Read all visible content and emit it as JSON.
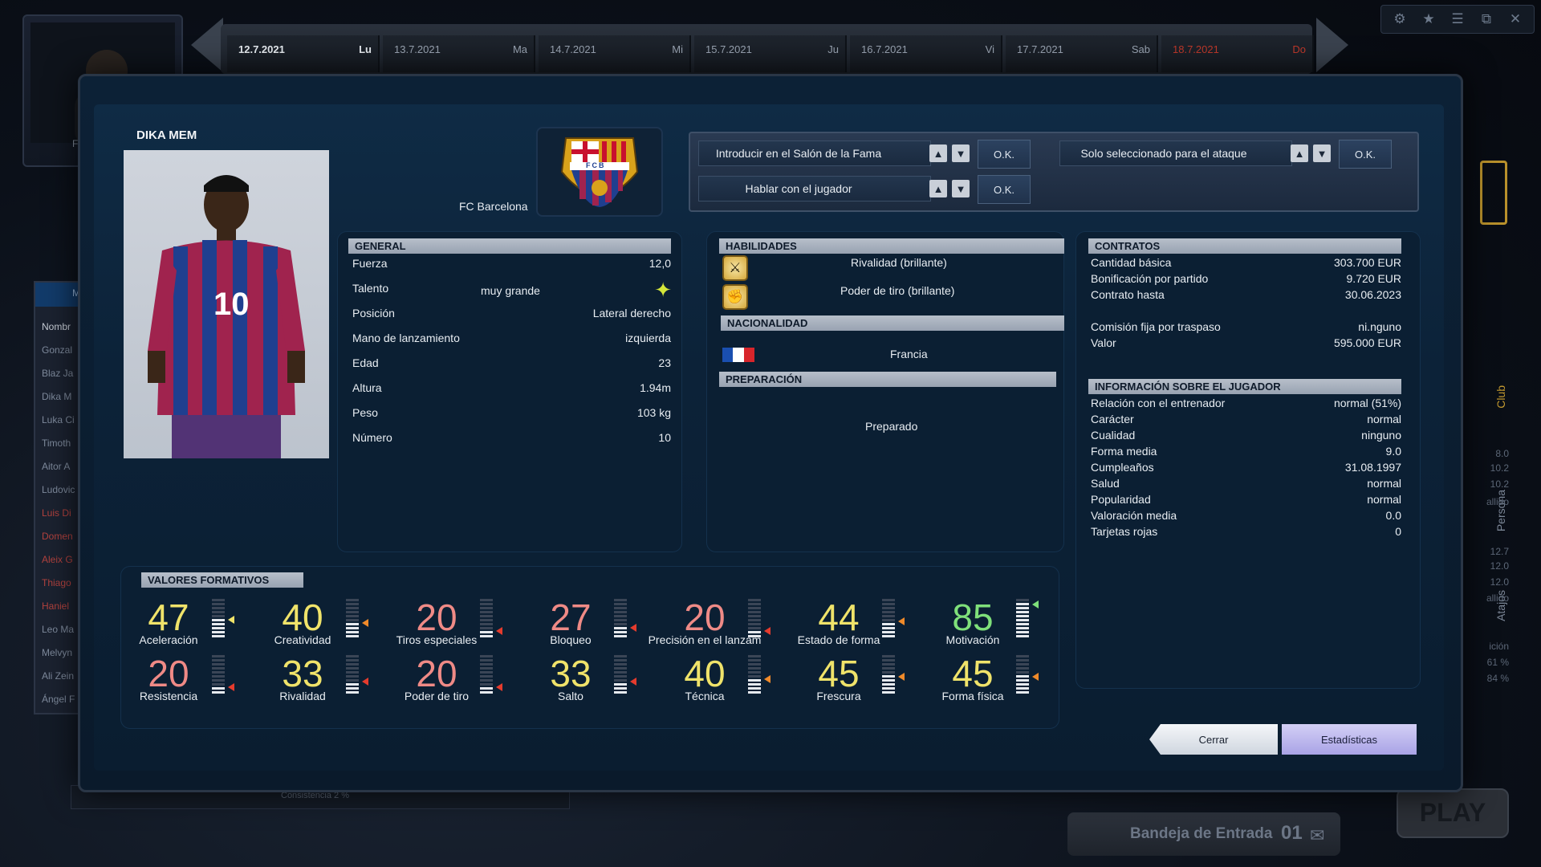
{
  "week_bar": {
    "days": [
      {
        "date": "12.7.2021",
        "day": "Lu",
        "active": true,
        "sunday": false
      },
      {
        "date": "13.7.2021",
        "day": "Ma",
        "active": false,
        "sunday": false
      },
      {
        "date": "14.7.2021",
        "day": "Mi",
        "active": false,
        "sunday": false
      },
      {
        "date": "15.7.2021",
        "day": "Ju",
        "active": false,
        "sunday": false
      },
      {
        "date": "16.7.2021",
        "day": "Vi",
        "active": false,
        "sunday": false
      },
      {
        "date": "17.7.2021",
        "day": "Sab",
        "active": false,
        "sunday": false
      },
      {
        "date": "18.7.2021",
        "day": "Do",
        "active": false,
        "sunday": true
      }
    ]
  },
  "background": {
    "list_header": "M",
    "list_items": [
      "Nombr",
      "Gonzal",
      "Blaz Ja",
      "Dika M",
      "Luka Ci",
      "Timoth",
      "Aitor A",
      "Ludovic",
      "Luis Di",
      "Domen",
      "Aleix G",
      "Thiago",
      "Haniel",
      "Leo Ma",
      "Melvyn",
      "Ali Zein",
      "Ángel F"
    ],
    "consistency": "Consistencia 2 %",
    "portrait_letter": "F",
    "right_tabs": {
      "club": "Club",
      "persona": "Persona",
      "atajos": "Atajos"
    },
    "right_nums": [
      "8.0",
      "10.2",
      "10.2",
      "allido",
      "12.7",
      "12.0",
      "12.0",
      "allido",
      "ición",
      "61 %",
      "84 %"
    ],
    "inbox_label": "Bandeja de Entrada",
    "inbox_count": "01",
    "play_label": "PLAY",
    "top_icons": [
      "gear-icon",
      "star-icon",
      "list-icon",
      "window-icon",
      "close-icon"
    ]
  },
  "player": {
    "name": "DIKA MEM",
    "club": "FC Barcelona",
    "shirt_number": "10",
    "crest_text": "FCB"
  },
  "actions": {
    "hall_of_fame": "Introducir en el Salón de la Fama",
    "talk": "Hablar con el jugador",
    "attack_only": "Solo seleccionado para el ataque",
    "ok": "O.K.",
    "up": "▲",
    "down": "▼"
  },
  "general": {
    "header": "GENERAL",
    "rows": [
      {
        "label": "Fuerza",
        "mid": "",
        "value": "12,0"
      },
      {
        "label": "Talento",
        "mid": "muy grande",
        "value": "✦"
      },
      {
        "label": "Posición",
        "mid": "",
        "value": "Lateral derecho"
      },
      {
        "label": "Mano de lanzamiento",
        "mid": "",
        "value": "izquierda"
      },
      {
        "label": "Edad",
        "mid": "",
        "value": "23"
      },
      {
        "label": "Altura",
        "mid": "",
        "value": "1.94m"
      },
      {
        "label": "Peso",
        "mid": "",
        "value": "103 kg"
      },
      {
        "label": "Número",
        "mid": "",
        "value": "10"
      }
    ]
  },
  "habilidades": {
    "header": "HABILIDADES",
    "items": [
      {
        "name": "Rivalidad (brillante)",
        "icon": "rivalry-icon"
      },
      {
        "name": "Poder de tiro (brillante)",
        "icon": "shot-power-icon"
      }
    ],
    "nacionalidad_header": "NACIONALIDAD",
    "nacionalidad": "Francia",
    "flag_colors": [
      "#1a4fb0",
      "#ffffff",
      "#d8252b"
    ],
    "preparacion_header": "PREPARACIÓN",
    "preparacion": "Preparado"
  },
  "contratos": {
    "header": "CONTRATOS",
    "rows": [
      {
        "label": "Cantidad básica",
        "value": "303.700 EUR"
      },
      {
        "label": "Bonificación por partido",
        "value": "9.720 EUR"
      },
      {
        "label": "Contrato hasta",
        "value": "30.06.2023"
      },
      {
        "label": "Comisión fija por traspaso",
        "value": "ni.nguno"
      },
      {
        "label": "Valor",
        "value": "595.000 EUR"
      }
    ],
    "info_header": "INFORMACIÓN SOBRE EL JUGADOR",
    "info_rows": [
      {
        "label": "Relación con el entrenador",
        "value": "normal (51%)"
      },
      {
        "label": "Carácter",
        "value": "normal"
      },
      {
        "label": "Cualidad",
        "value": "ninguno"
      },
      {
        "label": "Forma media",
        "value": "9.0"
      },
      {
        "label": "Cumpleaños",
        "value": "31.08.1997"
      },
      {
        "label": "Salud",
        "value": "normal"
      },
      {
        "label": "Popularidad",
        "value": "normal"
      },
      {
        "label": "Valoración media",
        "value": "0.0"
      },
      {
        "label": "Tarjetas rojas",
        "value": "0"
      }
    ]
  },
  "valores": {
    "header": "VALORES FORMATIVOS",
    "attributes": [
      {
        "value": "47",
        "label": "Aceleración",
        "color": "yellow",
        "arrow": "#f0e36a",
        "level": 0.47
      },
      {
        "value": "40",
        "label": "Creatividad",
        "color": "yellow",
        "arrow": "#f08a2a",
        "level": 0.4
      },
      {
        "value": "20",
        "label": "Tiros especiales",
        "color": "pink",
        "arrow": "#e53b2d",
        "level": 0.2
      },
      {
        "value": "27",
        "label": "Bloqueo",
        "color": "pink",
        "arrow": "#e53b2d",
        "level": 0.27
      },
      {
        "value": "20",
        "label": "Precisión en el lanzam",
        "color": "pink",
        "arrow": "#e53b2d",
        "level": 0.2
      },
      {
        "value": "44",
        "label": "Estado de forma",
        "color": "yellow",
        "arrow": "#f08a2a",
        "level": 0.44
      },
      {
        "value": "85",
        "label": "Motivación",
        "color": "green",
        "arrow": "#7fe07a",
        "level": 0.85
      },
      {
        "value": "20",
        "label": "Resistencia",
        "color": "pink",
        "arrow": "#e53b2d",
        "level": 0.2
      },
      {
        "value": "33",
        "label": "Rivalidad",
        "color": "yellow",
        "arrow": "#e53b2d",
        "level": 0.33
      },
      {
        "value": "20",
        "label": "Poder de tiro",
        "color": "pink",
        "arrow": "#e53b2d",
        "level": 0.2
      },
      {
        "value": "33",
        "label": "Salto",
        "color": "yellow",
        "arrow": "#e53b2d",
        "level": 0.33
      },
      {
        "value": "40",
        "label": "Técnica",
        "color": "yellow",
        "arrow": "#f08a2a",
        "level": 0.4
      },
      {
        "value": "45",
        "label": "Frescura",
        "color": "yellow",
        "arrow": "#f08a2a",
        "level": 0.45
      },
      {
        "value": "45",
        "label": "Forma física",
        "color": "yellow",
        "arrow": "#f08a2a",
        "level": 0.45
      }
    ]
  },
  "footer": {
    "close": "Cerrar",
    "stats": "Estadísticas"
  }
}
